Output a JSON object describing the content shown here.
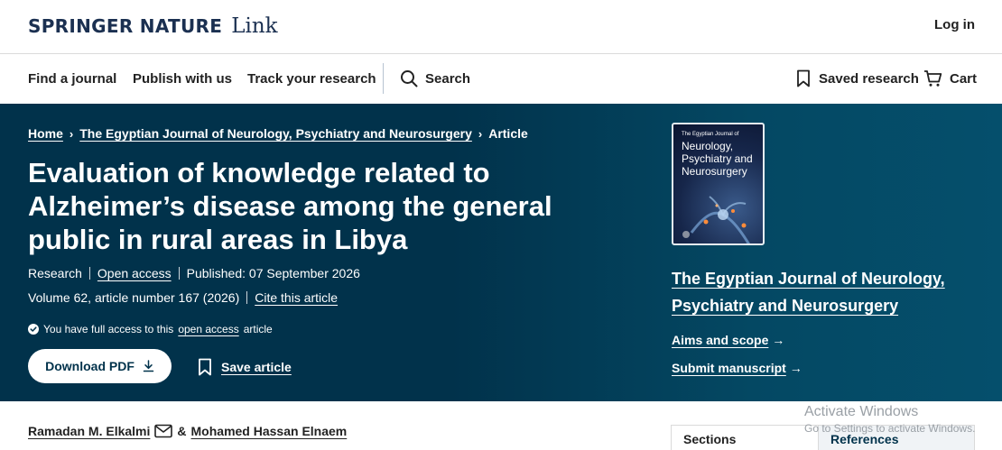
{
  "header": {
    "logo_brand": "SPRINGER NATURE",
    "logo_product": "Link",
    "login_label": "Log in"
  },
  "nav": {
    "find_journal": "Find a journal",
    "publish": "Publish with us",
    "track": "Track your research",
    "search": "Search",
    "saved": "Saved research",
    "cart": "Cart",
    "icons": [
      "search-icon",
      "bookmark-icon",
      "cart-icon"
    ]
  },
  "breadcrumb": {
    "home": "Home",
    "journal": "The Egyptian Journal of Neurology, Psychiatry and Neurosurgery",
    "current": "Article"
  },
  "article": {
    "title": "Evaluation of knowledge related to Alzheimer’s disease among the general public in rural areas in Libya",
    "type": "Research",
    "access": "Open access",
    "published": "Published: 07 September 2026",
    "volume": "Volume 62, article number 167 (2026)",
    "cite": "Cite this article",
    "access_note_prefix": "You have full access to this",
    "access_note_link": "open access",
    "access_note_suffix": "article",
    "download_pdf": "Download PDF",
    "save_article": "Save article"
  },
  "journal": {
    "cover_small": "The Egyptian Journal of",
    "cover_title": "Neurology, Psychiatry and Neurosurgery",
    "name": "The Egyptian Journal of Neurology, Psychiatry and Neurosurgery",
    "aims": "Aims and scope",
    "submit": "Submit manuscript"
  },
  "authors": {
    "first": "Ramadan M. Elkalmi",
    "and": "&",
    "second": "Mohamed Hassan Elnaem"
  },
  "sections_nav": {
    "sections": "Sections",
    "references": "References"
  },
  "watermark": {
    "title": "Activate Windows",
    "subtitle": "Go to Settings to activate Windows."
  },
  "colors": {
    "hero_bg": "#01324b",
    "brand_navy": "#1b3051",
    "text": "#222222"
  }
}
